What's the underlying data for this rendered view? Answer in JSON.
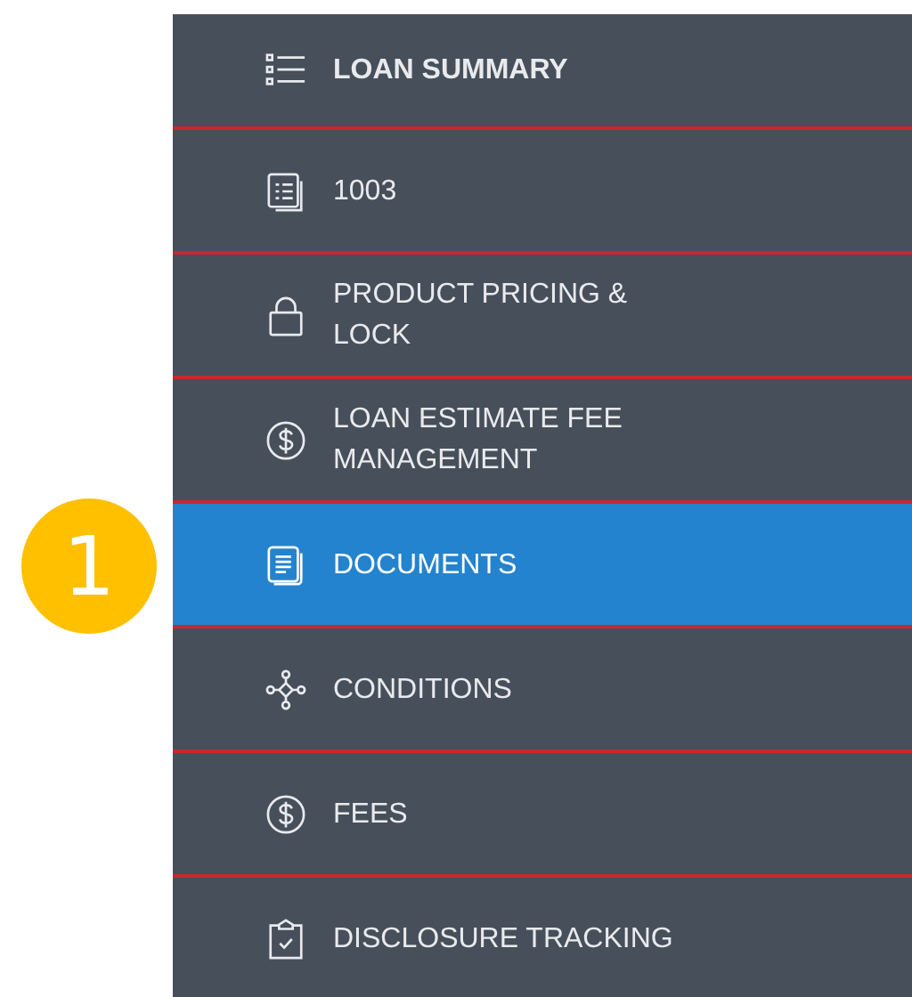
{
  "sidebar": {
    "items": [
      {
        "label": "LOAN SUMMARY",
        "kind": "list",
        "bold": true,
        "selected": false
      },
      {
        "label": "1003",
        "kind": "form",
        "bold": false,
        "selected": false
      },
      {
        "label": "PRODUCT PRICING & LOCK",
        "kind": "lock",
        "bold": false,
        "selected": false
      },
      {
        "label": "LOAN ESTIMATE FEE MANAGEMENT",
        "kind": "dollar",
        "bold": false,
        "selected": false
      },
      {
        "label": "DOCUMENTS",
        "kind": "document",
        "bold": false,
        "selected": true,
        "callout": "1"
      },
      {
        "label": "CONDITIONS",
        "kind": "network",
        "bold": false,
        "selected": false
      },
      {
        "label": "FEES",
        "kind": "dollar",
        "bold": false,
        "selected": false
      },
      {
        "label": "DISCLOSURE TRACKING",
        "kind": "clipboard",
        "bold": false,
        "selected": false
      }
    ]
  }
}
